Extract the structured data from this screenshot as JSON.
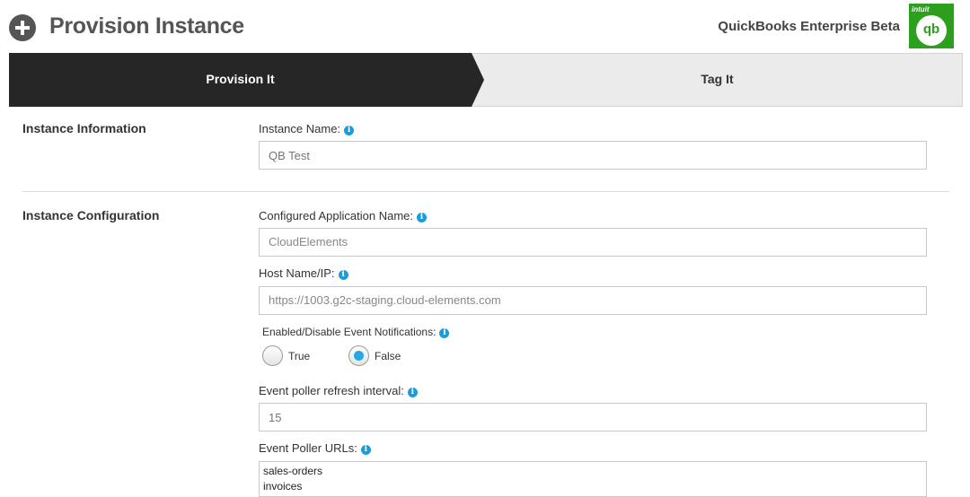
{
  "header": {
    "title": "Provision Instance",
    "app_name": "QuickBooks Enterprise Beta",
    "logo_brand": "intuit",
    "logo_text": "qb"
  },
  "steps": [
    {
      "label": "Provision It",
      "active": true
    },
    {
      "label": "Tag It",
      "active": false
    }
  ],
  "sections": {
    "instance_information": "Instance Information",
    "instance_configuration": "Instance Configuration"
  },
  "fields": {
    "instance_name": {
      "label": "Instance Name:",
      "placeholder": "QB Test"
    },
    "app_name": {
      "label": "Configured Application Name:",
      "value": "CloudElements"
    },
    "host": {
      "label": "Host Name/IP:",
      "value": "https://1003.g2c-staging.cloud-elements.com"
    },
    "event_notifications": {
      "label": "Enabled/Disable Event Notifications:",
      "options": [
        "True",
        "False"
      ],
      "selected": "False"
    },
    "poller_interval": {
      "label": "Event poller refresh interval:",
      "placeholder": "15"
    },
    "poller_urls": {
      "label": "Event Poller URLs:",
      "lines": [
        "sales-orders",
        "invoices"
      ]
    }
  },
  "info_glyph": "i",
  "colors": {
    "accent": "#1a9cd8",
    "active_step": "#262626",
    "logo": "#2ca01c"
  }
}
